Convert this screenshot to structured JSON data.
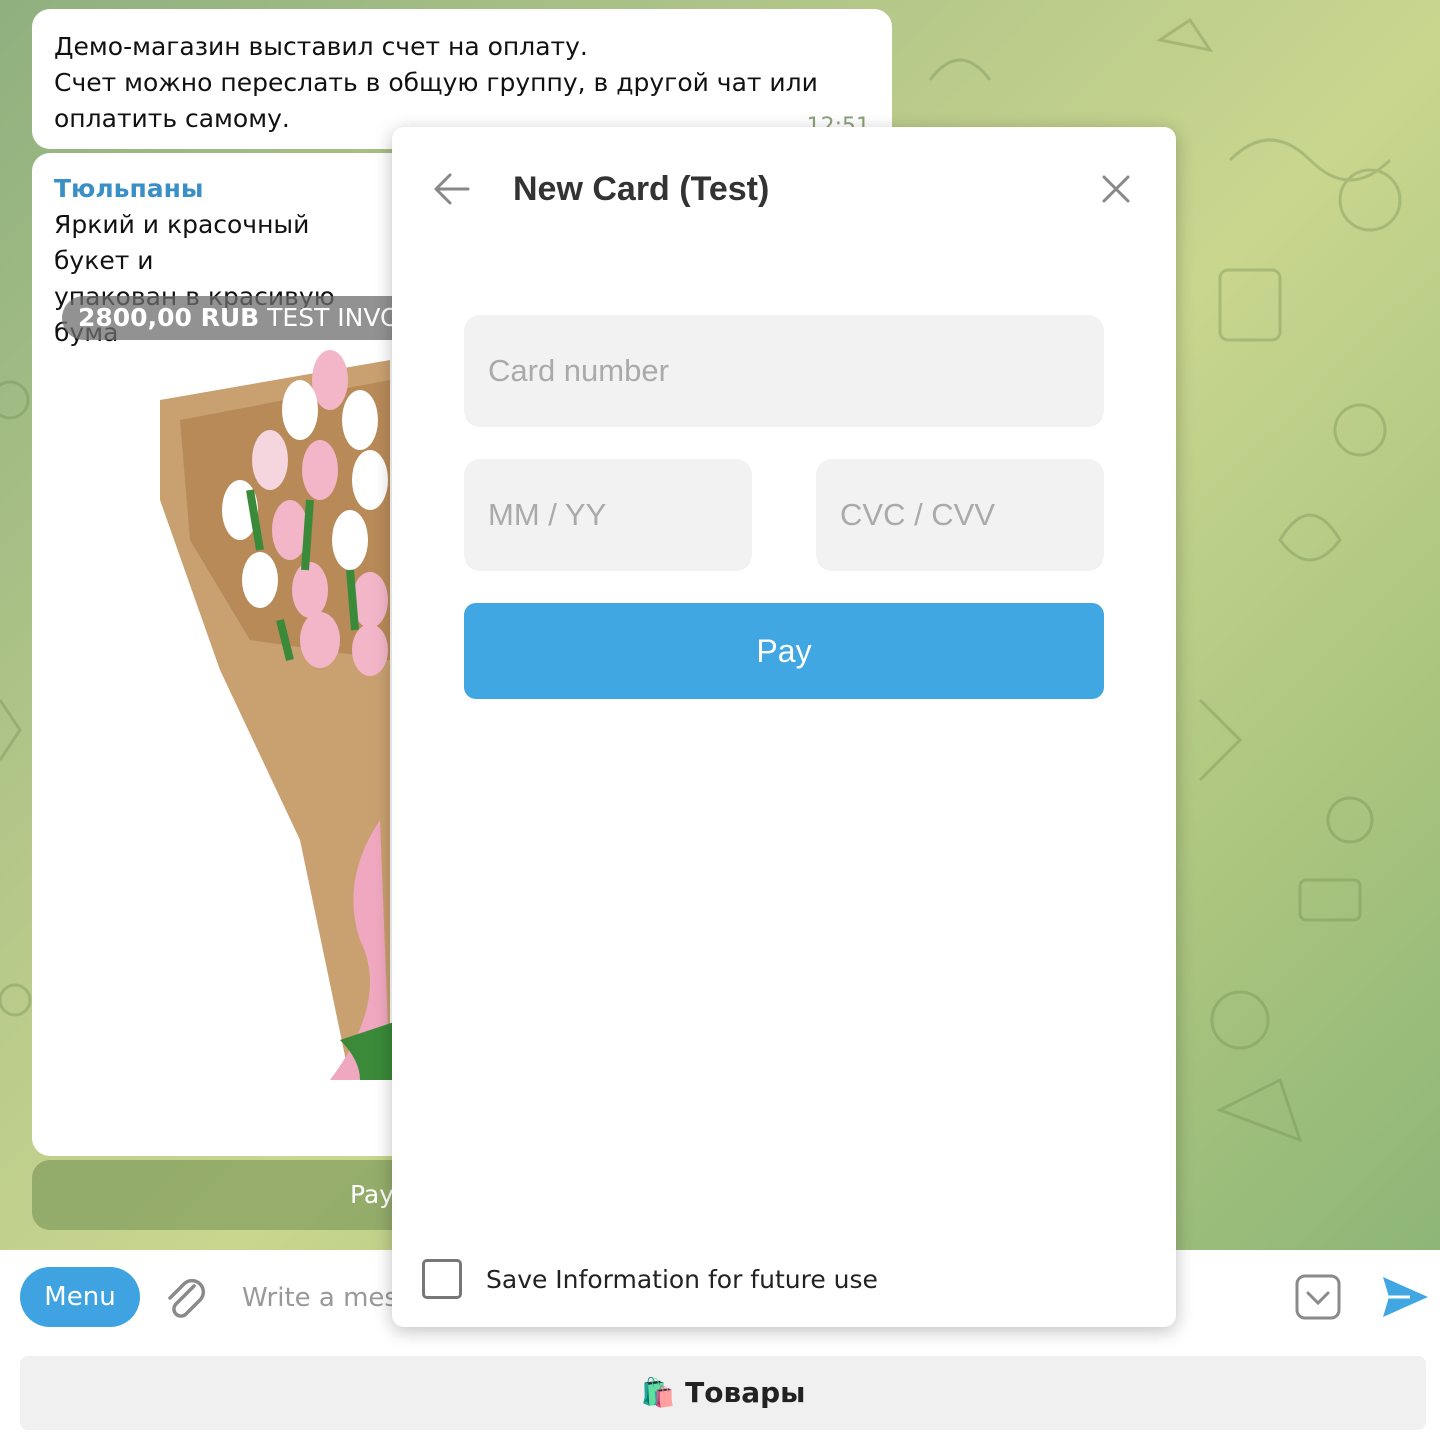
{
  "chat": {
    "message1": {
      "lines": [
        "Демо-магазин выставил счет на оплату.",
        "Счет можно переслать в общую группу, в другой чат или",
        "оплатить самому."
      ],
      "time": "12:51"
    },
    "message2": {
      "title": "Тюльпаны",
      "lines": [
        "Яркий и красочный букет и",
        "упакован в красивую бума"
      ],
      "invoice_amount": "2800,00 RUB",
      "invoice_label": "TEST INVOIC",
      "pay_button": "Pay"
    }
  },
  "input_bar": {
    "menu_label": "Menu",
    "placeholder": "Write a mess",
    "goods_button": "🛍️ Товары"
  },
  "modal": {
    "title": "New Card (Test)",
    "card_number_placeholder": "Card number",
    "expiry_placeholder": "MM / YY",
    "cvc_placeholder": "CVC / CVV",
    "pay_label": "Pay",
    "save_info_label": "Save Information for future use",
    "save_info_checked": false
  },
  "colors": {
    "accent": "#40a7e3",
    "menu_button": "#3ea3e0",
    "title_link": "#3a8fc6"
  }
}
